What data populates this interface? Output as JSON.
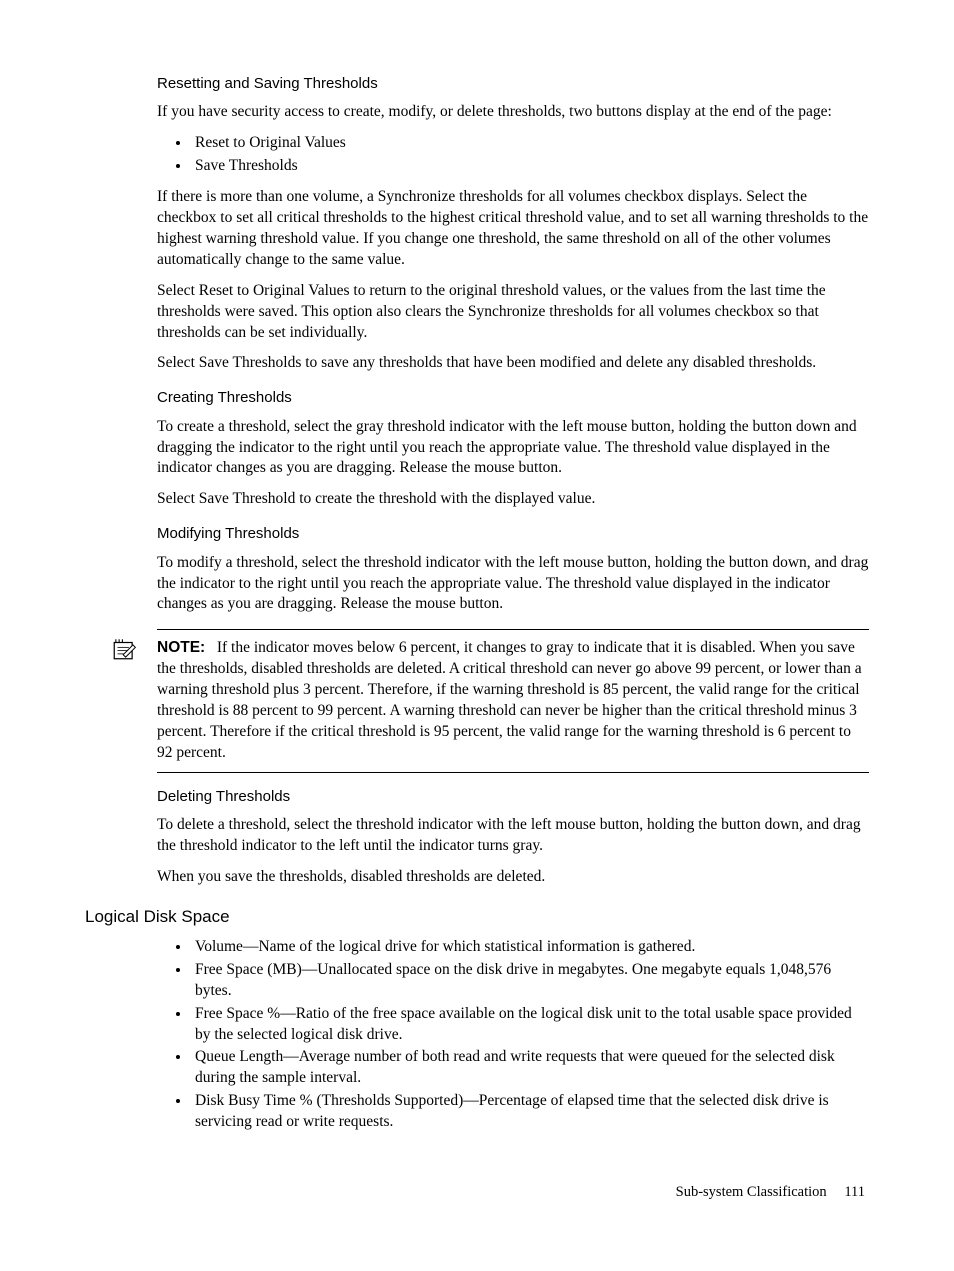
{
  "sec1": {
    "title": "Resetting and Saving Thresholds",
    "p1": "If you have security access to create, modify, or delete thresholds, two buttons display at the end of the page:",
    "li1": "Reset to Original Values",
    "li2": "Save Thresholds",
    "p2": "If there is more than one volume, a Synchronize thresholds for all volumes checkbox displays. Select the checkbox to set all critical thresholds to the highest critical threshold value, and to set all warning thresholds to the highest warning threshold value. If you change one threshold, the same threshold on all of the other volumes automatically change to the same value.",
    "p3": "Select Reset to Original Values to return to the original threshold values, or the values from the last time the thresholds were saved. This option also clears the Synchronize thresholds for all volumes checkbox so that thresholds can be set individually.",
    "p4": "Select Save Thresholds to save any thresholds that have been modified and delete any disabled thresholds."
  },
  "sec2": {
    "title": "Creating Thresholds",
    "p1": "To create a threshold, select the gray threshold indicator with the left mouse button, holding the button down and dragging the indicator to the right until you reach the appropriate value. The threshold value displayed in the indicator changes as you are dragging. Release the mouse button.",
    "p2": "Select Save Threshold to create the threshold with the displayed value."
  },
  "sec3": {
    "title": "Modifying Thresholds",
    "p1": "To modify a threshold, select the threshold indicator with the left mouse button, holding the button down, and drag the indicator to the right until you reach the appropriate value. The threshold value displayed in the indicator changes as you are dragging. Release the mouse button."
  },
  "note": {
    "label": "NOTE:",
    "body": "If the indicator moves below 6 percent, it changes to gray to indicate that it is disabled. When you save the thresholds, disabled thresholds are deleted. A critical threshold can never go above 99 percent, or lower than a warning threshold plus 3 percent. Therefore, if the warning threshold is 85 percent, the valid range for the critical threshold is 88 percent to 99 percent. A warning threshold can never be higher than the critical threshold minus 3 percent. Therefore if the critical threshold is 95 percent, the valid range for the warning threshold is 6 percent to 92 percent."
  },
  "sec4": {
    "title": "Deleting Thresholds",
    "p1": "To delete a threshold, select the threshold indicator with the left mouse button, holding the button down, and drag the threshold indicator to the left until the indicator turns gray.",
    "p2": "When you save the thresholds, disabled thresholds are deleted."
  },
  "sec5": {
    "title": "Logical Disk Space",
    "li1": "Volume—Name of the logical drive for which statistical information is gathered.",
    "li2": "Free Space (MB)—Unallocated space on the disk drive in megabytes. One megabyte equals 1,048,576 bytes.",
    "li3": "Free Space %—Ratio of the free space available on the logical disk unit to the total usable space provided by the selected logical disk drive.",
    "li4": "Queue Length—Average number of both read and write requests that were queued for the selected disk during the sample interval.",
    "li5": "Disk Busy Time % (Thresholds Supported)—Percentage of elapsed time that the selected disk drive is servicing read or write requests."
  },
  "footer": {
    "section": "Sub-system Classification",
    "page": "111"
  }
}
